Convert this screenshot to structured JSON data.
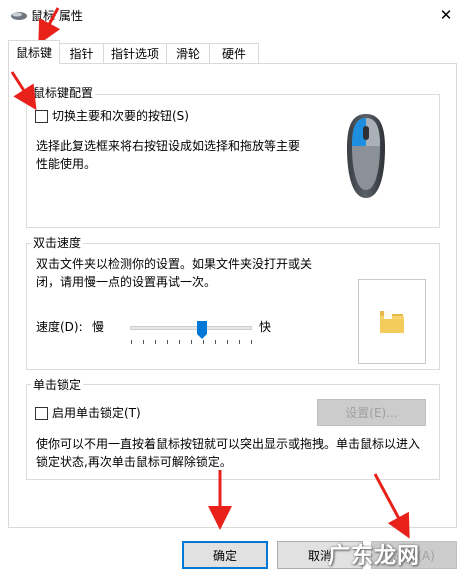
{
  "window": {
    "title": "鼠标 属性",
    "icon": "mouse-icon",
    "close_icon": "close-icon"
  },
  "tabs": [
    {
      "label": "鼠标键",
      "active": true
    },
    {
      "label": "指针",
      "active": false
    },
    {
      "label": "指针选项",
      "active": false
    },
    {
      "label": "滑轮",
      "active": false
    },
    {
      "label": "硬件",
      "active": false
    }
  ],
  "button_config": {
    "group_title": "鼠标键配置",
    "switch_label": "切换主要和次要的按钮(S)",
    "switch_checked": false,
    "description": "选择此复选框来将右按钮设成如选择和拖放等主要性能使用。",
    "image_icon": "mouse-illustration-icon"
  },
  "double_click": {
    "group_title": "双击速度",
    "description": "双击文件夹以检测你的设置。如果文件夹没打开或关闭，请用慢一点的设置再试一次。",
    "speed_label": "速度(D):",
    "slow_label": "慢",
    "fast_label": "快",
    "speed_value_fraction": 0.6,
    "folder_icon": "folder-icon"
  },
  "click_lock": {
    "group_title": "单击锁定",
    "enable_label": "启用单击锁定(T)",
    "enable_checked": false,
    "settings_button": "设置(E)...",
    "description": "使你可以不用一直按着鼠标按钮就可以突出显示或拖拽。单击鼠标以进入锁定状态,再次单击鼠标可解除锁定。"
  },
  "footer": {
    "ok_label": "确定",
    "cancel_label": "取消",
    "apply_label": "应用(A)"
  },
  "watermark": {
    "text": "广东龙网"
  },
  "colors": {
    "accent": "#0078d7",
    "annotation_arrow": "#e8221b"
  }
}
